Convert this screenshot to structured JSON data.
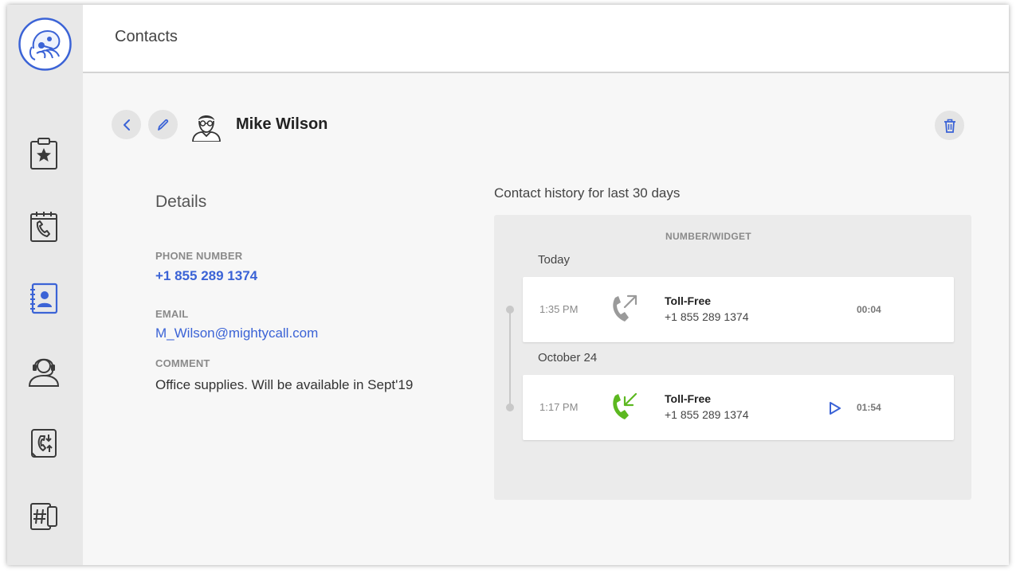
{
  "header": {
    "title": "Contacts"
  },
  "contact": {
    "name": "Mike Wilson"
  },
  "details": {
    "title": "Details",
    "phone_label": "PHONE NUMBER",
    "phone": "+1 855 289 1374",
    "email_label": "EMAIL",
    "email": "M_Wilson@mightycall.com",
    "comment_label": "COMMENT",
    "comment": "Office supplies. Will be available in Sept'19"
  },
  "history": {
    "title": "Contact history for last 30 days",
    "column_header": "NUMBER/WIDGET",
    "groups": [
      {
        "label": "Today",
        "calls": [
          {
            "time": "1:35 PM",
            "direction": "outgoing",
            "name": "Toll-Free",
            "number": "+1 855 289 1374",
            "duration": "00:04",
            "has_recording": false
          }
        ]
      },
      {
        "label": "October 24",
        "calls": [
          {
            "time": "1:17 PM",
            "direction": "incoming",
            "name": "Toll-Free",
            "number": "+1 855 289 1374",
            "duration": "01:54",
            "has_recording": true
          }
        ]
      }
    ]
  },
  "sidebar": {
    "items": [
      {
        "icon": "clipboard-star-icon"
      },
      {
        "icon": "calendar-phone-icon"
      },
      {
        "icon": "address-book-icon",
        "active": true
      },
      {
        "icon": "headset-agent-icon"
      },
      {
        "icon": "call-routing-icon"
      },
      {
        "icon": "hash-device-icon"
      }
    ]
  },
  "colors": {
    "accent": "#3b63d6",
    "incoming_call": "#5cb820",
    "outgoing_call": "#9a9a9a",
    "sidebar_bg": "#e8e8e8",
    "icon_dark": "#3a3a3a"
  }
}
